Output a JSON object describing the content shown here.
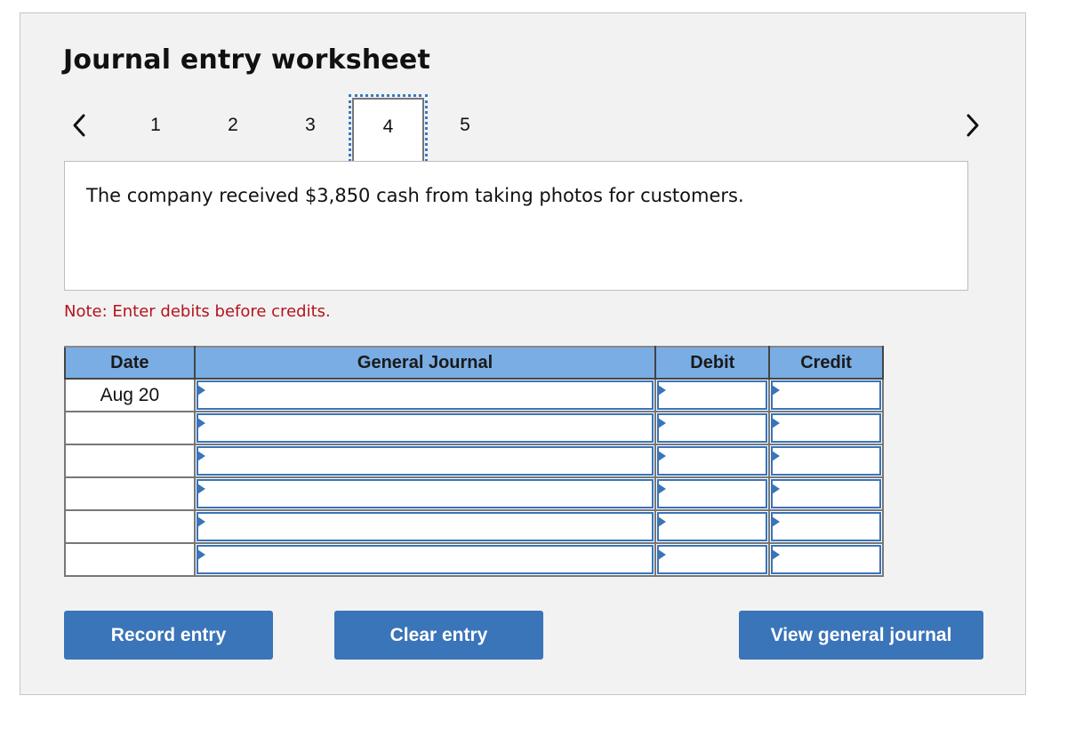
{
  "worksheet": {
    "title": "Journal entry worksheet",
    "nav": {
      "prev_icon": "chevron-left-icon",
      "next_icon": "chevron-right-icon",
      "pages": [
        "1",
        "2",
        "3",
        "4",
        "5"
      ],
      "current_page": "4"
    },
    "description": "The company received $3,850 cash from taking photos for customers.",
    "note": "Note: Enter debits before credits.",
    "table": {
      "headers": {
        "date": "Date",
        "general_journal": "General Journal",
        "debit": "Debit",
        "credit": "Credit"
      },
      "rows": [
        {
          "date": "Aug 20",
          "account": "",
          "debit": "",
          "credit": ""
        },
        {
          "date": "",
          "account": "",
          "debit": "",
          "credit": ""
        },
        {
          "date": "",
          "account": "",
          "debit": "",
          "credit": ""
        },
        {
          "date": "",
          "account": "",
          "debit": "",
          "credit": ""
        },
        {
          "date": "",
          "account": "",
          "debit": "",
          "credit": ""
        },
        {
          "date": "",
          "account": "",
          "debit": "",
          "credit": ""
        }
      ]
    },
    "buttons": {
      "record": "Record entry",
      "clear": "Clear entry",
      "view": "View general journal"
    },
    "colors": {
      "accent": "#3a74b9",
      "header_bg": "#79ade4",
      "note": "#b3141c",
      "panel_bg": "#f2f2f2"
    }
  }
}
